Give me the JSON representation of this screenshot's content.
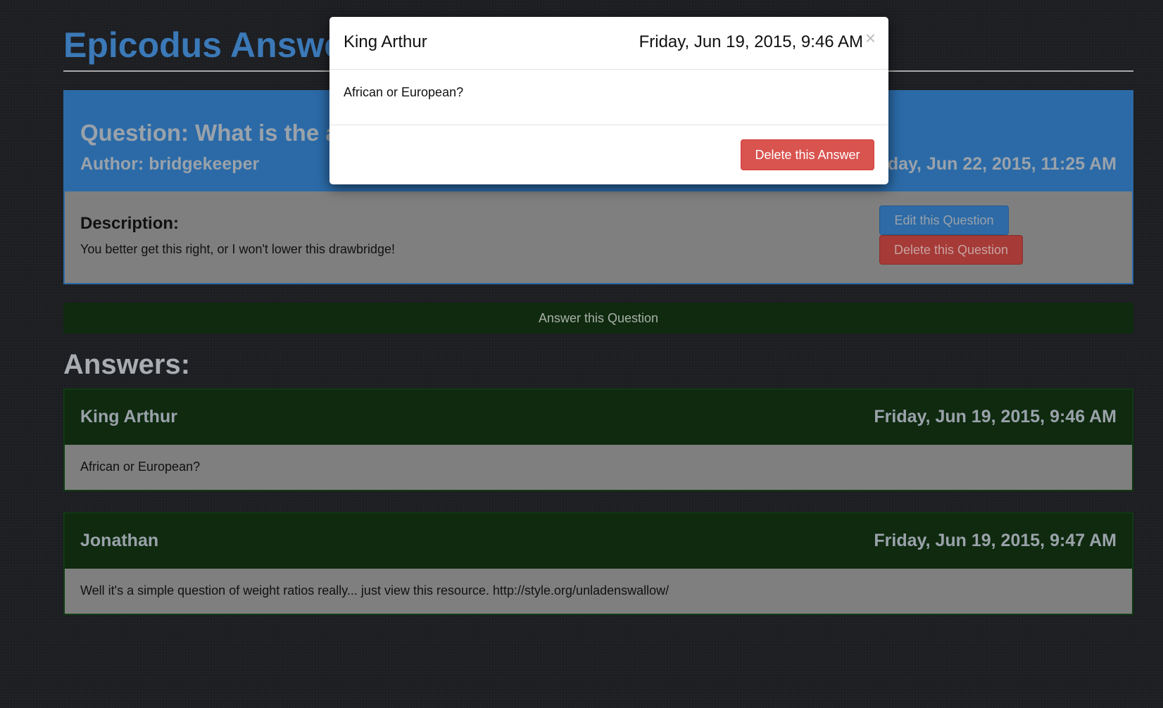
{
  "page": {
    "title": "Epicodus Answers"
  },
  "question": {
    "title": "Question: What is the airspeed velocity of an unladen swallow?",
    "author": "Author: bridgekeeper",
    "date": "Monday, Jun 22, 2015, 11:25 AM",
    "description_label": "Description:",
    "description": "You better get this right, or I won't lower this drawbridge!",
    "edit_label": "Edit this Question",
    "delete_label": "Delete this Question"
  },
  "answer_button_label": "Answer this Question",
  "answers_heading": "Answers:",
  "answers": [
    {
      "author": "King Arthur",
      "date": "Friday, Jun 19, 2015, 9:46 AM",
      "text": "African or European?"
    },
    {
      "author": "Jonathan",
      "date": "Friday, Jun 19, 2015, 9:47 AM",
      "text": "Well it's a simple question of weight ratios really... just view this resource. http://style.org/unladenswallow/"
    }
  ],
  "modal": {
    "author": "King Arthur",
    "date": "Friday, Jun 19, 2015, 9:46 AM",
    "close_symbol": "×",
    "text": "African or European?",
    "delete_label": "Delete this Answer"
  },
  "colors": {
    "primary": "#2b6aa7",
    "success_dark": "#0f2a0f",
    "danger": "#d9534f"
  }
}
